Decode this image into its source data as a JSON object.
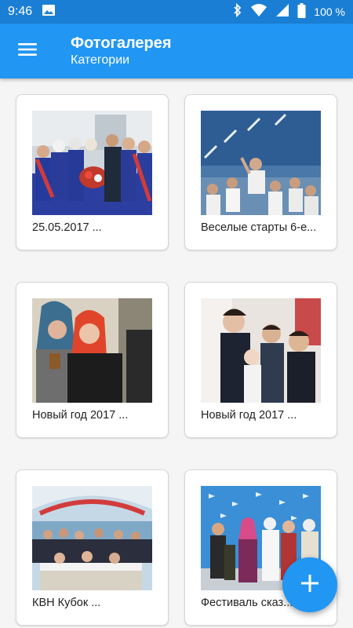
{
  "status_bar": {
    "time": "9:46",
    "battery_percent": "100 %",
    "icons": [
      "image-icon",
      "bluetooth-icon",
      "wifi-icon",
      "cell-signal-icon",
      "battery-icon"
    ]
  },
  "app_bar": {
    "title": "Фотогалерея",
    "subtitle": "Категории",
    "menu_icon": "menu-icon",
    "color": "#2196f3"
  },
  "categories": [
    {
      "label": "25.05.2017 ..."
    },
    {
      "label": "Веселые старты 6-е..."
    },
    {
      "label": "Новый год 2017 ..."
    },
    {
      "label": "Новый год 2017 ..."
    },
    {
      "label": "КВН Кубок ..."
    },
    {
      "label": "Фестиваль сказ..."
    }
  ],
  "fab": {
    "icon": "plus-icon",
    "color": "#2196f3"
  }
}
